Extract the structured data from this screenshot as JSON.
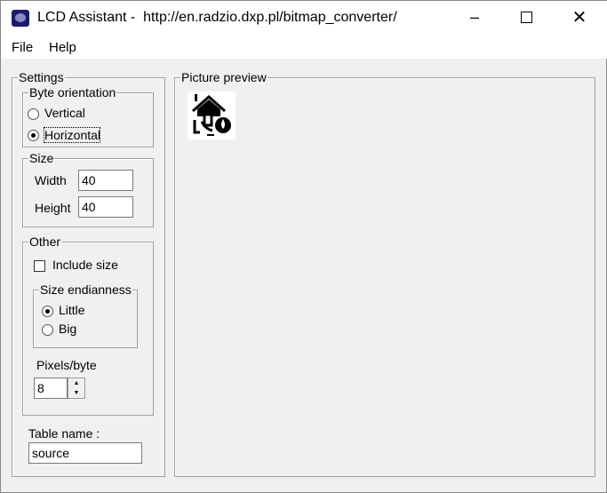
{
  "window": {
    "title": "LCD Assistant -  http://en.radzio.dxp.pl/bitmap_converter/"
  },
  "menu": [
    "File",
    "Help"
  ],
  "settings": {
    "label": "Settings",
    "byte_orientation": {
      "label": "Byte orientation",
      "options": [
        "Vertical",
        "Horizontal"
      ],
      "selected": "Horizontal"
    },
    "size": {
      "label": "Size",
      "width_label": "Width",
      "width": "40",
      "height_label": "Height",
      "height": "40"
    },
    "other": {
      "label": "Other",
      "include_size_label": "Include size",
      "include_size": false,
      "endianness": {
        "label": "Size endianness",
        "options": [
          "Little",
          "Big"
        ],
        "selected": "Little"
      },
      "pixels_per_byte_label": "Pixels/byte",
      "pixels_per_byte": "8"
    },
    "table_name_label": "Table name :",
    "table_name": "source"
  },
  "preview": {
    "label": "Picture preview"
  }
}
